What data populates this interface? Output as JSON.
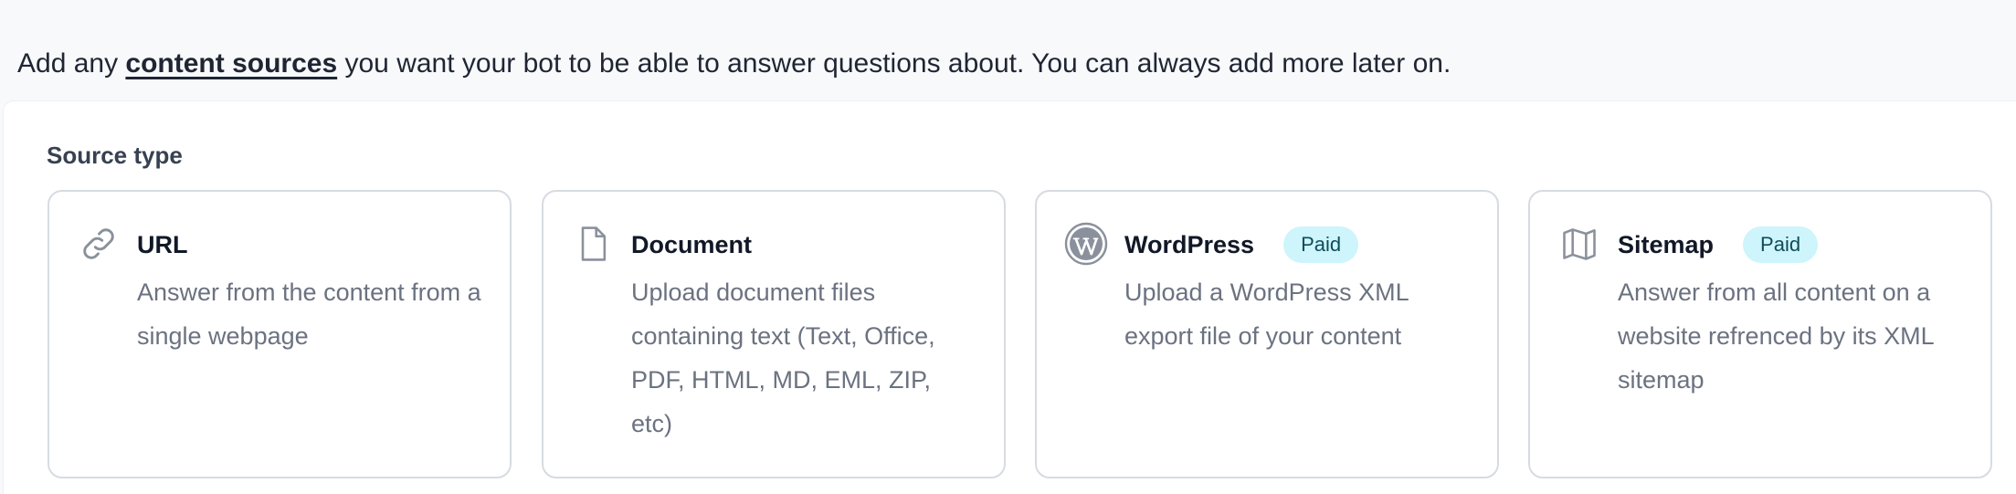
{
  "intro": {
    "prefix": "Add any ",
    "link": "content sources",
    "suffix": " you want your bot to be able to answer questions about. You can always add more later on."
  },
  "panel": {
    "label": "Source type"
  },
  "cards": [
    {
      "icon": "link-icon",
      "title": "URL",
      "badge": "",
      "desc": "Answer from the content from a single webpage"
    },
    {
      "icon": "document-icon",
      "title": "Document",
      "badge": "",
      "desc": "Upload document files containing text (Text, Office, PDF, HTML, MD, EML, ZIP, etc)"
    },
    {
      "icon": "wordpress-icon",
      "title": "WordPress",
      "badge": "Paid",
      "desc": "Upload a WordPress XML export file of your content"
    },
    {
      "icon": "map-icon",
      "title": "Sitemap",
      "badge": "Paid",
      "desc": "Answer from all content on a website refrenced by its XML sitemap"
    }
  ],
  "colors": {
    "page_bg": "#f8f9fb",
    "card_border": "#d7dbe1",
    "badge_bg": "#cdf5fb",
    "badge_text": "#0f4c5c",
    "desc_text": "#6b7280",
    "icon_gray": "#8a919c"
  }
}
